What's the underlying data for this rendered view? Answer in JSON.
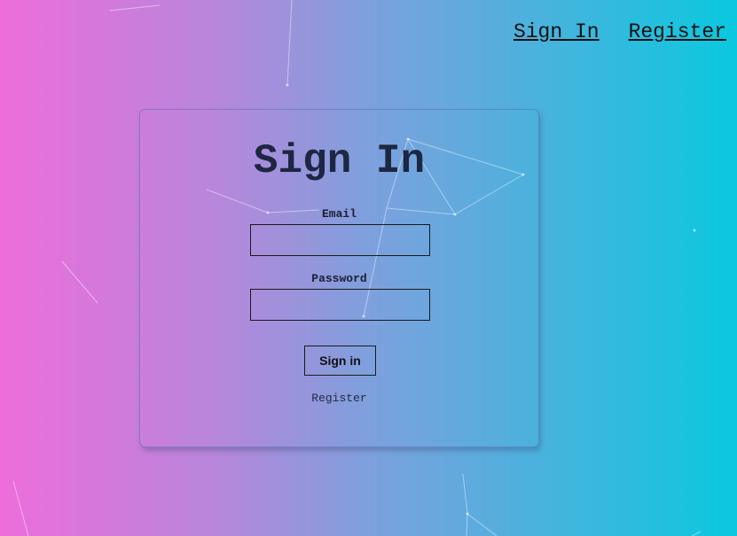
{
  "nav": {
    "sign_in": "Sign In",
    "register": "Register"
  },
  "form": {
    "title": "Sign In",
    "email_label": "Email",
    "email_value": "",
    "password_label": "Password",
    "password_value": "",
    "submit_label": "Sign in",
    "register_link": "Register"
  },
  "colors": {
    "gradient_start": "#ee6ddb",
    "gradient_end": "#0ac8df",
    "title": "#1d2742",
    "decorative_lines": "#ffffff"
  }
}
